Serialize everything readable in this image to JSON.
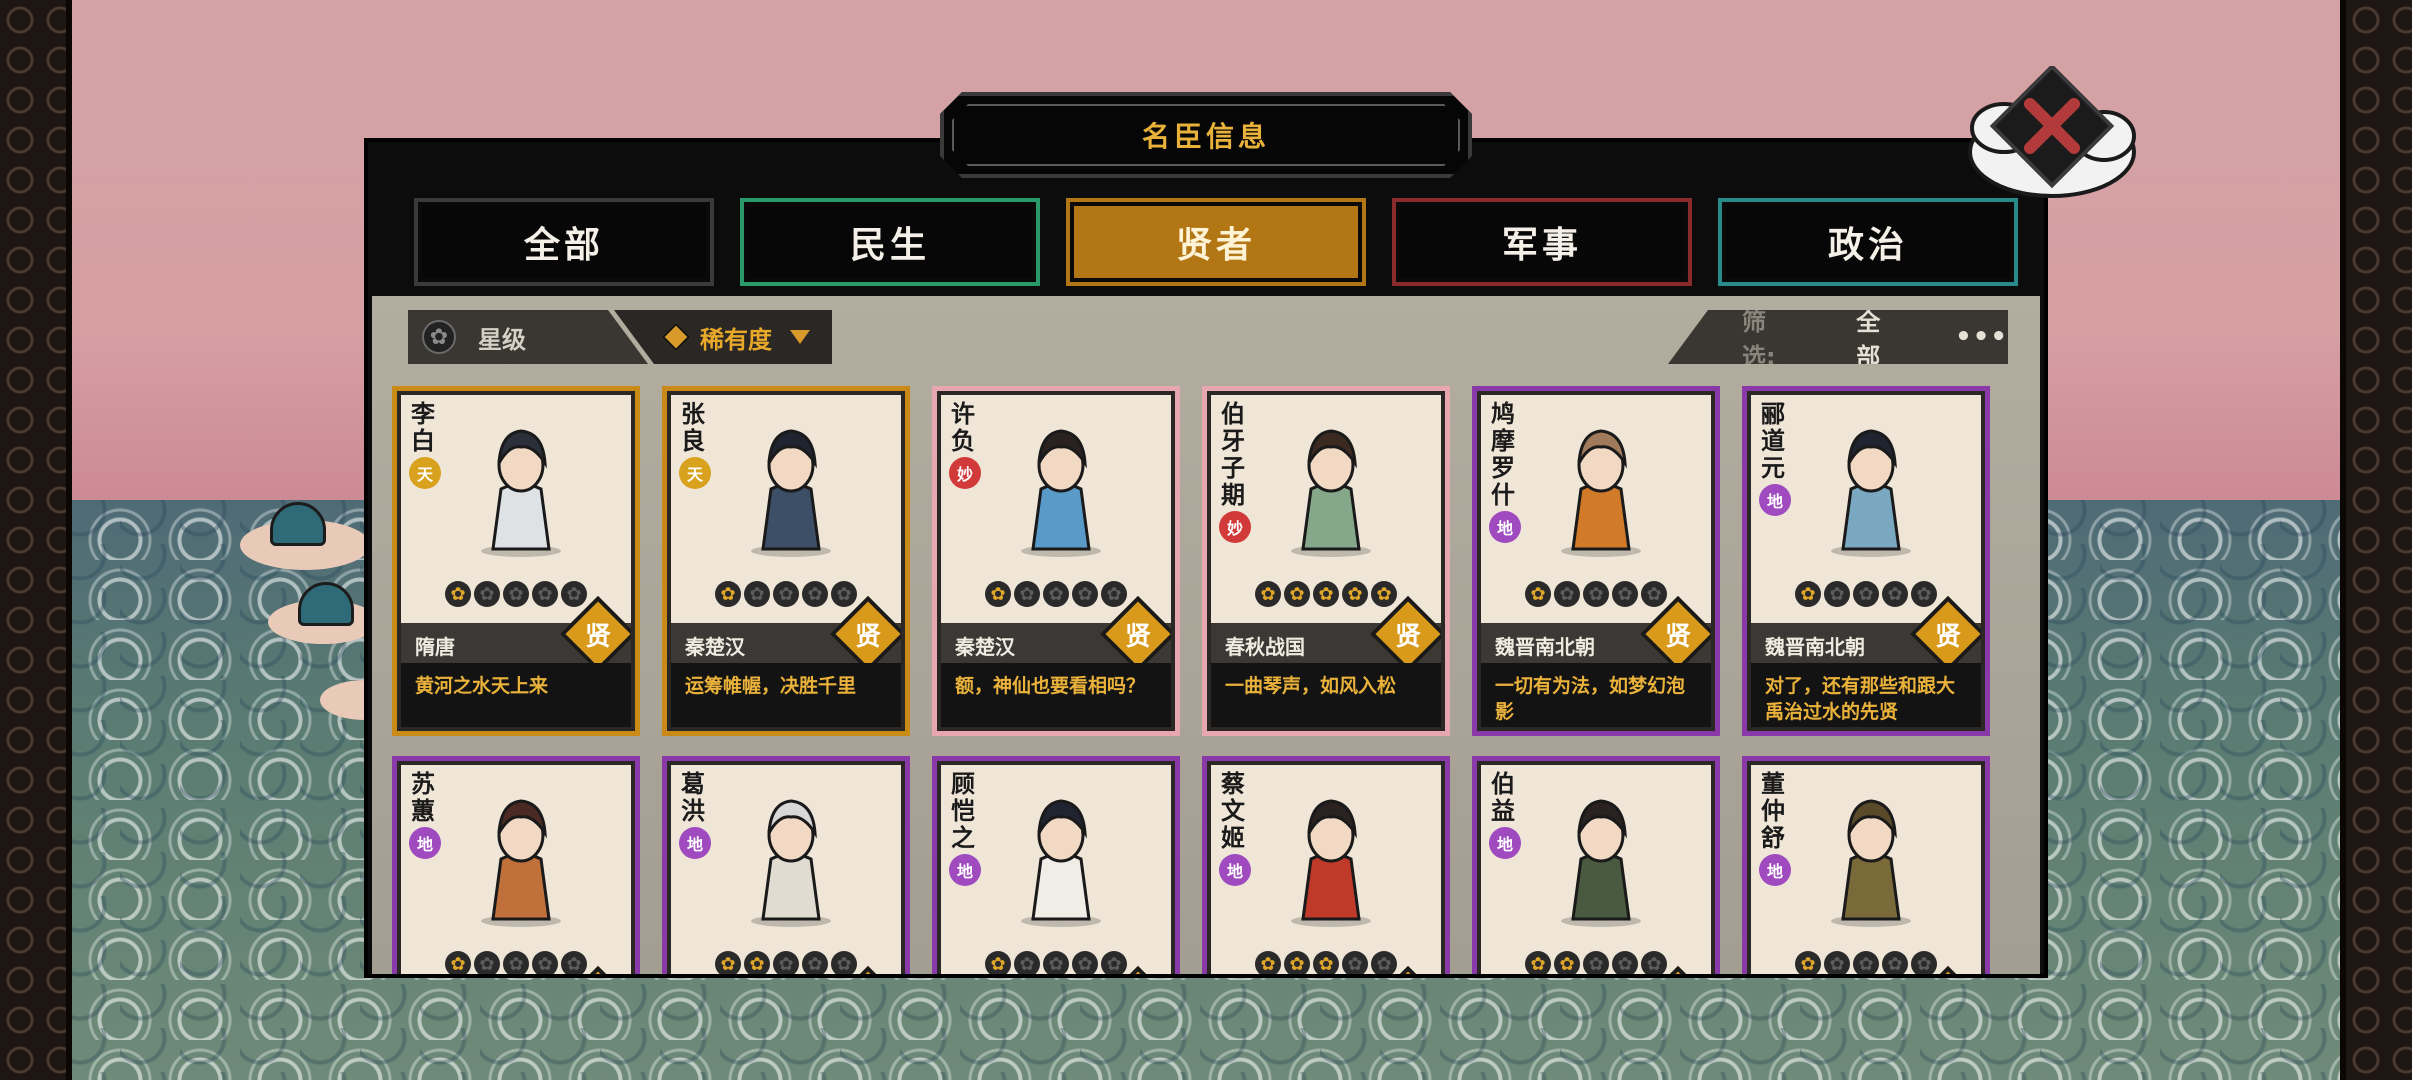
{
  "window": {
    "title": "名臣信息"
  },
  "tabs": [
    {
      "label": "全部",
      "color": "#3a3a3a"
    },
    {
      "label": "民生",
      "color": "#2a9a6a"
    },
    {
      "label": "贤者",
      "color": "#b27614",
      "active": true
    },
    {
      "label": "军事",
      "color": "#8a2a2a"
    },
    {
      "label": "政治",
      "color": "#2a8a8a"
    }
  ],
  "sort": {
    "star_label": "星级",
    "rarity_label": "稀有度"
  },
  "filter": {
    "label": "筛选:",
    "value": "全部",
    "more": "•••"
  },
  "card_type_label": "贤",
  "cards": [
    {
      "name": "李白",
      "grade": "天",
      "grade_color": "#d8a21e",
      "stars": 1,
      "era": "隋唐",
      "quote": "黄河之水天上来",
      "border": "#c98a18",
      "robe": "#dfe2e4",
      "hair": "#2a2f3a"
    },
    {
      "name": "张良",
      "grade": "天",
      "grade_color": "#d8a21e",
      "stars": 1,
      "era": "秦楚汉",
      "quote": "运筹帷幄，决胜千里",
      "border": "#c98a18",
      "robe": "#3d4f66",
      "hair": "#1f2430"
    },
    {
      "name": "许负",
      "grade": "妙",
      "grade_color": "#d23a3a",
      "stars": 1,
      "era": "秦楚汉",
      "quote": "额，神仙也要看相吗？",
      "border": "#e8a6b0",
      "robe": "#5a9ac8",
      "hair": "#2a2220"
    },
    {
      "name": "伯牙子期",
      "grade": "妙",
      "grade_color": "#d23a3a",
      "stars": 5,
      "era": "春秋战国",
      "quote": "一曲琴声，如风入松",
      "border": "#e8a6b0",
      "robe": "#86a88a",
      "hair": "#3a2a20"
    },
    {
      "name": "鸠摩罗什",
      "grade": "地",
      "grade_color": "#a04ac0",
      "stars": 1,
      "era": "魏晋南北朝",
      "quote": "一切有为法，如梦幻泡影",
      "border": "#8a3aa8",
      "robe": "#d07a2a",
      "hair": "#a07a5a"
    },
    {
      "name": "郦道元",
      "grade": "地",
      "grade_color": "#a04ac0",
      "stars": 1,
      "era": "魏晋南北朝",
      "quote": "对了，还有那些和跟大禹治过水的先贤",
      "border": "#8a3aa8",
      "robe": "#7aa8c0",
      "hair": "#1f2430"
    },
    {
      "name": "苏蕙",
      "grade": "地",
      "grade_color": "#a04ac0",
      "stars": 1,
      "era": "",
      "quote": "",
      "border": "#8a3aa8",
      "robe": "#c0703a",
      "hair": "#4a2a22"
    },
    {
      "name": "葛洪",
      "grade": "地",
      "grade_color": "#a04ac0",
      "stars": 2,
      "era": "",
      "quote": "",
      "border": "#8a3aa8",
      "robe": "#e0dcd2",
      "hair": "#d8d8d8"
    },
    {
      "name": "顾恺之",
      "grade": "地",
      "grade_color": "#a04ac0",
      "stars": 1,
      "era": "",
      "quote": "",
      "border": "#8a3aa8",
      "robe": "#f0ece6",
      "hair": "#1f2430"
    },
    {
      "name": "蔡文姬",
      "grade": "地",
      "grade_color": "#a04ac0",
      "stars": 3,
      "era": "",
      "quote": "",
      "border": "#8a3aa8",
      "robe": "#c03a2a",
      "hair": "#2a2220"
    },
    {
      "name": "伯益",
      "grade": "地",
      "grade_color": "#a04ac0",
      "stars": 2,
      "era": "",
      "quote": "",
      "border": "#8a3aa8",
      "robe": "#4a5a40",
      "hair": "#2a2220"
    },
    {
      "name": "董仲舒",
      "grade": "地",
      "grade_color": "#a04ac0",
      "stars": 1,
      "era": "",
      "quote": "",
      "border": "#8a3aa8",
      "robe": "#7a6a3a",
      "hair": "#5a4a2a"
    }
  ],
  "icons": {
    "close": "close-x-icon",
    "star_sort": "flower-star-icon",
    "rarity": "diamond-icon"
  }
}
